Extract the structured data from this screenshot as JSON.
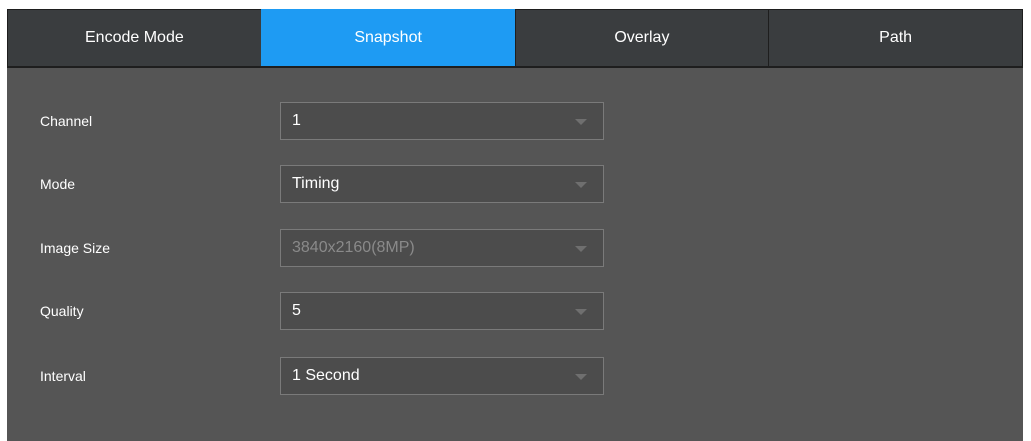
{
  "tabs": [
    {
      "label": "Encode Mode",
      "active": false
    },
    {
      "label": "Snapshot",
      "active": true
    },
    {
      "label": "Overlay",
      "active": false
    },
    {
      "label": "Path",
      "active": false
    }
  ],
  "form": {
    "channel": {
      "label": "Channel",
      "value": "1",
      "disabled": false
    },
    "mode": {
      "label": "Mode",
      "value": "Timing",
      "disabled": false
    },
    "image_size": {
      "label": "Image Size",
      "value": "3840x2160(8MP)",
      "disabled": true
    },
    "quality": {
      "label": "Quality",
      "value": "5",
      "disabled": false
    },
    "interval": {
      "label": "Interval",
      "value": "1 Second",
      "disabled": false
    }
  },
  "colors": {
    "active_tab": "#1e9bf3",
    "tab_background": "#3a3d3f",
    "panel_background": "#555555",
    "select_background": "#4c4c4c",
    "disabled_text": "#8a8a8a"
  },
  "icons": {
    "dropdown": "chevron-down-icon"
  }
}
